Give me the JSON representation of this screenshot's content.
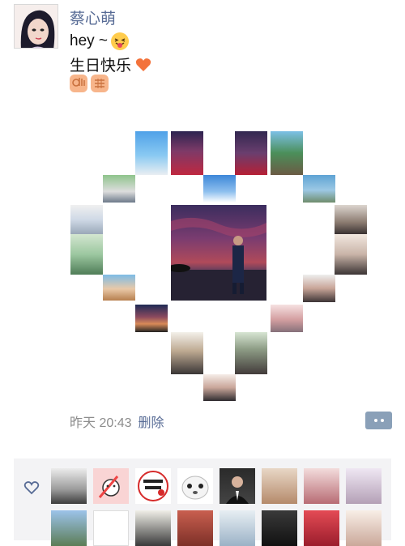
{
  "post": {
    "author": "蔡心萌",
    "line1_text": "hey ~",
    "line2_text": "生日快乐",
    "time": "昨天 20:43",
    "delete_label": "删除"
  },
  "colors": {
    "link": "#576b95",
    "meta": "#8c8c8c",
    "likes_bg": "#f3f3f5",
    "comment_button": "#8aa0b8"
  },
  "icons": {
    "line1_emoji": "tongue-out-emoji",
    "line2_emoji": "orange-heart-emoji",
    "line3_emojis": [
      "ok-hand-emoji",
      "fist-emoji"
    ],
    "comment": "more-dots-icon",
    "likes": "heart-outline-icon"
  },
  "likers_row_count": 8
}
